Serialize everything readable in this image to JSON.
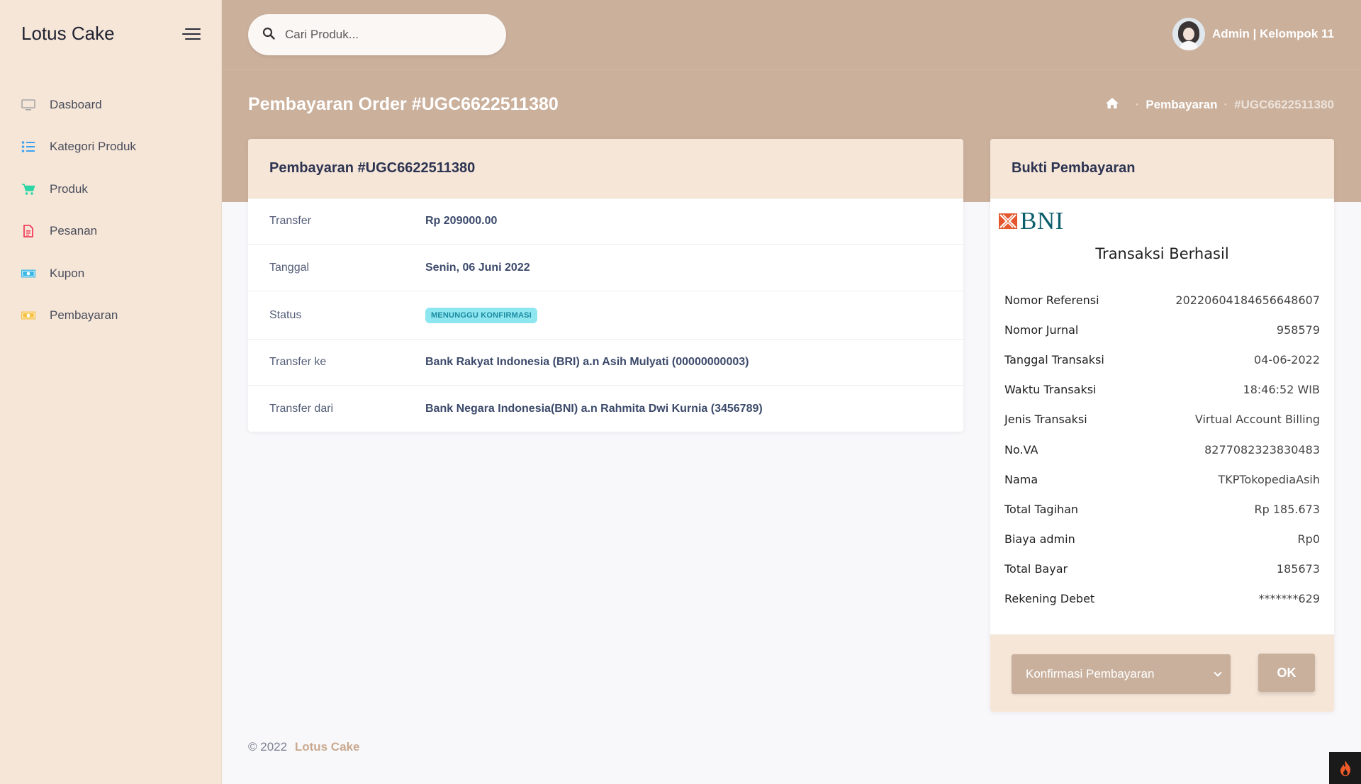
{
  "app": {
    "brand": "Lotus Cake"
  },
  "sidebar": {
    "items": [
      {
        "label": "Dasboard",
        "icon": "monitor-icon",
        "color": "#a7a7a7"
      },
      {
        "label": "Kategori Produk",
        "icon": "list-icon",
        "color": "#3ea2f1"
      },
      {
        "label": "Produk",
        "icon": "cart-icon",
        "color": "#2dd6a5"
      },
      {
        "label": "Pesanan",
        "icon": "document-icon",
        "color": "#f23e5b"
      },
      {
        "label": "Kupon",
        "icon": "money-icon",
        "color": "#37b6e6"
      },
      {
        "label": "Pembayaran",
        "icon": "money-icon",
        "color": "#f6c141"
      }
    ]
  },
  "header": {
    "search_placeholder": "Cari Produk...",
    "user_name": "Admin | Kelompok 11"
  },
  "page": {
    "title": "Pembayaran Order #UGC6622511380",
    "breadcrumb": {
      "parent": "Pembayaran",
      "current": "#UGC6622511380"
    }
  },
  "detail": {
    "title": "Pembayaran #UGC6622511380",
    "rows": [
      {
        "label": "Transfer",
        "value": "Rp 209000.00"
      },
      {
        "label": "Tanggal",
        "value": "Senin, 06 Juni 2022"
      },
      {
        "label": "Status",
        "value": "MENUNGGU KONFIRMASI"
      },
      {
        "label": "Transfer ke",
        "value": "Bank Rakyat Indonesia (BRI) a.n Asih Mulyati (00000000003)"
      },
      {
        "label": "Transfer dari",
        "value": "Bank Negara Indonesia(BNI) a.n Rahmita Dwi Kurnia (3456789)"
      }
    ]
  },
  "proof": {
    "title": "Bukti Pembayaran",
    "bank_logo": "BNI",
    "heading": "Transaksi Berhasil",
    "rows": [
      {
        "key": "Nomor Referensi",
        "value": "20220604184656648607"
      },
      {
        "key": "Nomor Jurnal",
        "value": "958579"
      },
      {
        "key": "Tanggal Transaksi",
        "value": "04-06-2022"
      },
      {
        "key": "Waktu Transaksi",
        "value": "18:46:52 WIB"
      },
      {
        "key": "Jenis Transaksi",
        "value": "Virtual Account Billing"
      },
      {
        "key": "No.VA",
        "value": "8277082323830483"
      },
      {
        "key": "Nama",
        "value": "TKPTokopediaAsih"
      },
      {
        "key": "Total Tagihan",
        "value": "Rp 185.673"
      },
      {
        "key": "Biaya admin",
        "value": "Rp0"
      },
      {
        "key": "Total Bayar",
        "value": "185673"
      },
      {
        "key": "Rekening Debet",
        "value": "*******629"
      }
    ],
    "select_value": "Konfirmasi Pembayaran",
    "ok_label": "OK"
  },
  "footer": {
    "copyright": "© 2022",
    "brand": "Lotus Cake"
  },
  "colors": {
    "sidebar_bg": "#f6e6d8",
    "accent": "#cbb09c",
    "badge": "#8ee6f0"
  }
}
